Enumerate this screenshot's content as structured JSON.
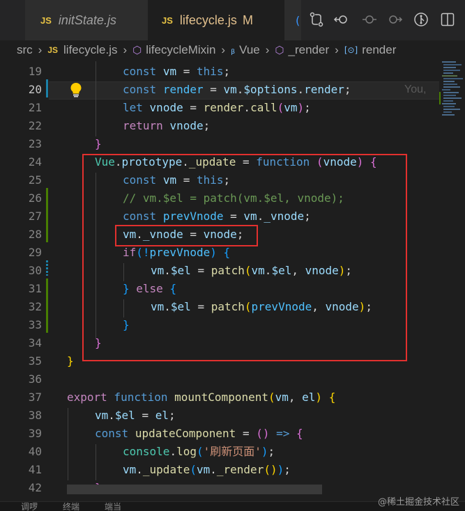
{
  "tabs": [
    {
      "icon": "JS",
      "label": "initState.js",
      "active": false
    },
    {
      "icon": "JS",
      "label": "lifecycle.js",
      "modified": "M",
      "active": true
    }
  ],
  "breadcrumb": {
    "items": [
      "src",
      "lifecycle.js",
      "lifecycleMixin",
      "Vue",
      "_render",
      "render"
    ]
  },
  "blame_text": "You,",
  "lines": [
    {
      "n": "19"
    },
    {
      "n": "20"
    },
    {
      "n": "21"
    },
    {
      "n": "22"
    },
    {
      "n": "23"
    },
    {
      "n": "24"
    },
    {
      "n": "25"
    },
    {
      "n": "26"
    },
    {
      "n": "27"
    },
    {
      "n": "28"
    },
    {
      "n": "29"
    },
    {
      "n": "30"
    },
    {
      "n": "31"
    },
    {
      "n": "32"
    },
    {
      "n": "33"
    },
    {
      "n": "34"
    },
    {
      "n": "35"
    },
    {
      "n": "36"
    },
    {
      "n": "37"
    },
    {
      "n": "38"
    },
    {
      "n": "39"
    },
    {
      "n": "40"
    },
    {
      "n": "41"
    },
    {
      "n": "42"
    }
  ],
  "code": {
    "l19": {
      "k1": "const",
      "v1": "vm",
      "op": " = ",
      "k2": "this",
      "end": ";"
    },
    "l20": {
      "k1": "const",
      "v1": "render",
      "op": " = ",
      "v2": "vm",
      "dot1": ".",
      "v3": "$options",
      "dot2": ".",
      "v4": "render",
      "end": ";"
    },
    "l21": {
      "k1": "let",
      "v1": "vnode",
      "op": " = ",
      "f1": "render",
      "dot": ".",
      "f2": "call",
      "p1": "(",
      "v2": "vm",
      "p2": ")",
      "end": ";"
    },
    "l22": {
      "k1": "return",
      "v1": "vnode",
      "end": ";"
    },
    "l23": {
      "b": "}"
    },
    "l24": {
      "c1": "Vue",
      "d1": ".",
      "v1": "prototype",
      "d2": ".",
      "f1": "_update",
      "op": " = ",
      "k1": "function",
      "p1": " (",
      "v2": "vnode",
      "p2": ") ",
      "b": "{"
    },
    "l25": {
      "k1": "const",
      "v1": "vm",
      "op": " = ",
      "k2": "this",
      "end": ";"
    },
    "l26": {
      "cmt": "// vm.$el = patch(vm.$el, vnode);"
    },
    "l27": {
      "k1": "const",
      "v1": "prevVnode",
      "op": " = ",
      "v2": "vm",
      "d": ".",
      "v3": "_vnode",
      "end": ";"
    },
    "l28": {
      "v1": "vm",
      "d": ".",
      "v2": "_vnode",
      "op": " = ",
      "v3": "vnode",
      "end": ";"
    },
    "l29": {
      "k1": "if",
      "p1": "(!",
      "v1": "prevVnode",
      "p2": ") ",
      "b": "{"
    },
    "l30": {
      "v1": "vm",
      "d1": ".",
      "v2": "$el",
      "op": " = ",
      "f1": "patch",
      "p1": "(",
      "v3": "vm",
      "d2": ".",
      "v4": "$el",
      "cm": ", ",
      "v5": "vnode",
      "p2": ")",
      "end": ";"
    },
    "l31": {
      "b1": "}",
      "k1": " else ",
      "b2": "{"
    },
    "l32": {
      "v1": "vm",
      "d1": ".",
      "v2": "$el",
      "op": " = ",
      "f1": "patch",
      "p1": "(",
      "v3": "prevVnode",
      "cm": ", ",
      "v4": "vnode",
      "p2": ")",
      "end": ";"
    },
    "l33": {
      "b": "}"
    },
    "l34": {
      "b": "}"
    },
    "l35": {
      "b": "}"
    },
    "l37": {
      "k1": "export",
      "k2": " function ",
      "f1": "mountComponent",
      "p1": "(",
      "v1": "vm",
      "cm": ", ",
      "v2": "el",
      "p2": ") ",
      "b": "{"
    },
    "l38": {
      "v1": "vm",
      "d": ".",
      "v2": "$el",
      "op": " = ",
      "v3": "el",
      "end": ";"
    },
    "l39": {
      "k1": "const",
      "f1": "updateComponent",
      "op": " = ",
      "p": "()",
      "arrow": " => ",
      "b": "{"
    },
    "l40": {
      "v1": "console",
      "d": ".",
      "f1": "log",
      "p1": "(",
      "s": "'刷新页面'",
      "p2": ")",
      "end": ";"
    },
    "l41": {
      "v1": "vm",
      "d1": ".",
      "f1": "_update",
      "p1": "(",
      "v2": "vm",
      "d2": ".",
      "f2": "_render",
      "p2": "()",
      "p3": ")",
      "end": ";"
    },
    "l42": {
      "b": "}"
    }
  },
  "status": {
    "left1": "调啰",
    "left2": "终端",
    "left3": "端当"
  },
  "watermark": "@稀土掘金技术社区",
  "colors": {
    "accent_box": "#e2302e",
    "keyword": "#569cd6",
    "variable": "#9cdcfe",
    "function": "#dcdcaa"
  }
}
